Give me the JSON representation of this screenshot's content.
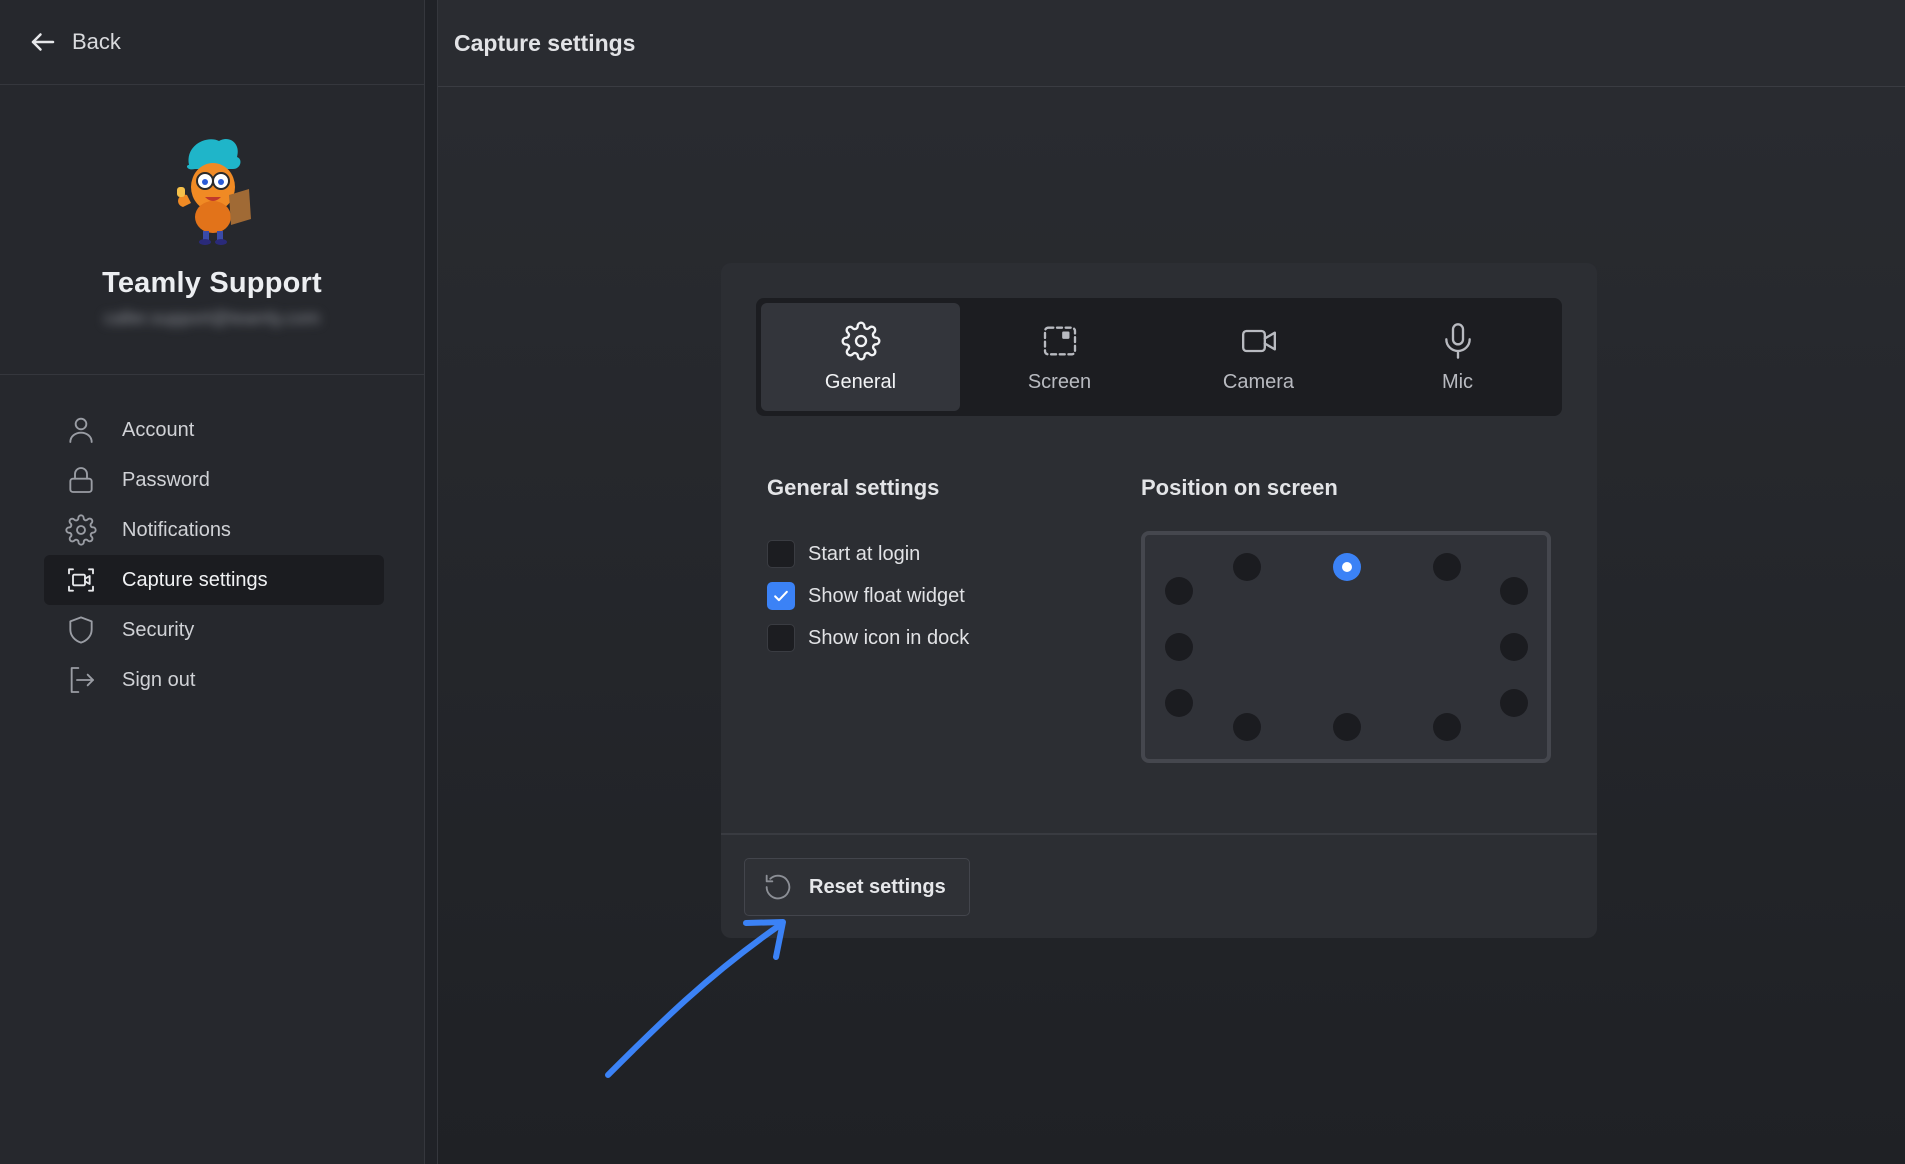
{
  "sidebar": {
    "back_label": "Back",
    "profile": {
      "name": "Teamly Support",
      "email": "caller.support@teamly.com"
    },
    "items": [
      {
        "label": "Account",
        "icon": "user-icon"
      },
      {
        "label": "Password",
        "icon": "lock-icon"
      },
      {
        "label": "Notifications",
        "icon": "gear-icon"
      },
      {
        "label": "Capture settings",
        "icon": "capture-icon",
        "active": true
      },
      {
        "label": "Security",
        "icon": "shield-icon"
      },
      {
        "label": "Sign out",
        "icon": "sign-out-icon"
      }
    ]
  },
  "header": {
    "title": "Capture settings"
  },
  "capture": {
    "tabs": [
      {
        "label": "General",
        "icon": "gear-icon",
        "active": true
      },
      {
        "label": "Screen",
        "icon": "screen-select-icon"
      },
      {
        "label": "Camera",
        "icon": "camera-icon"
      },
      {
        "label": "Mic",
        "icon": "microphone-icon"
      }
    ],
    "general": {
      "title": "General settings",
      "options": [
        {
          "label": "Start at login",
          "checked": false
        },
        {
          "label": "Show float widget",
          "checked": true
        },
        {
          "label": "Show icon in dock",
          "checked": false
        }
      ]
    },
    "position": {
      "title": "Position on screen",
      "selected": "top-center"
    },
    "reset_label": "Reset settings"
  },
  "colors": {
    "accent": "#3b82f6",
    "background": "#202227",
    "card": "#2c2e33"
  }
}
